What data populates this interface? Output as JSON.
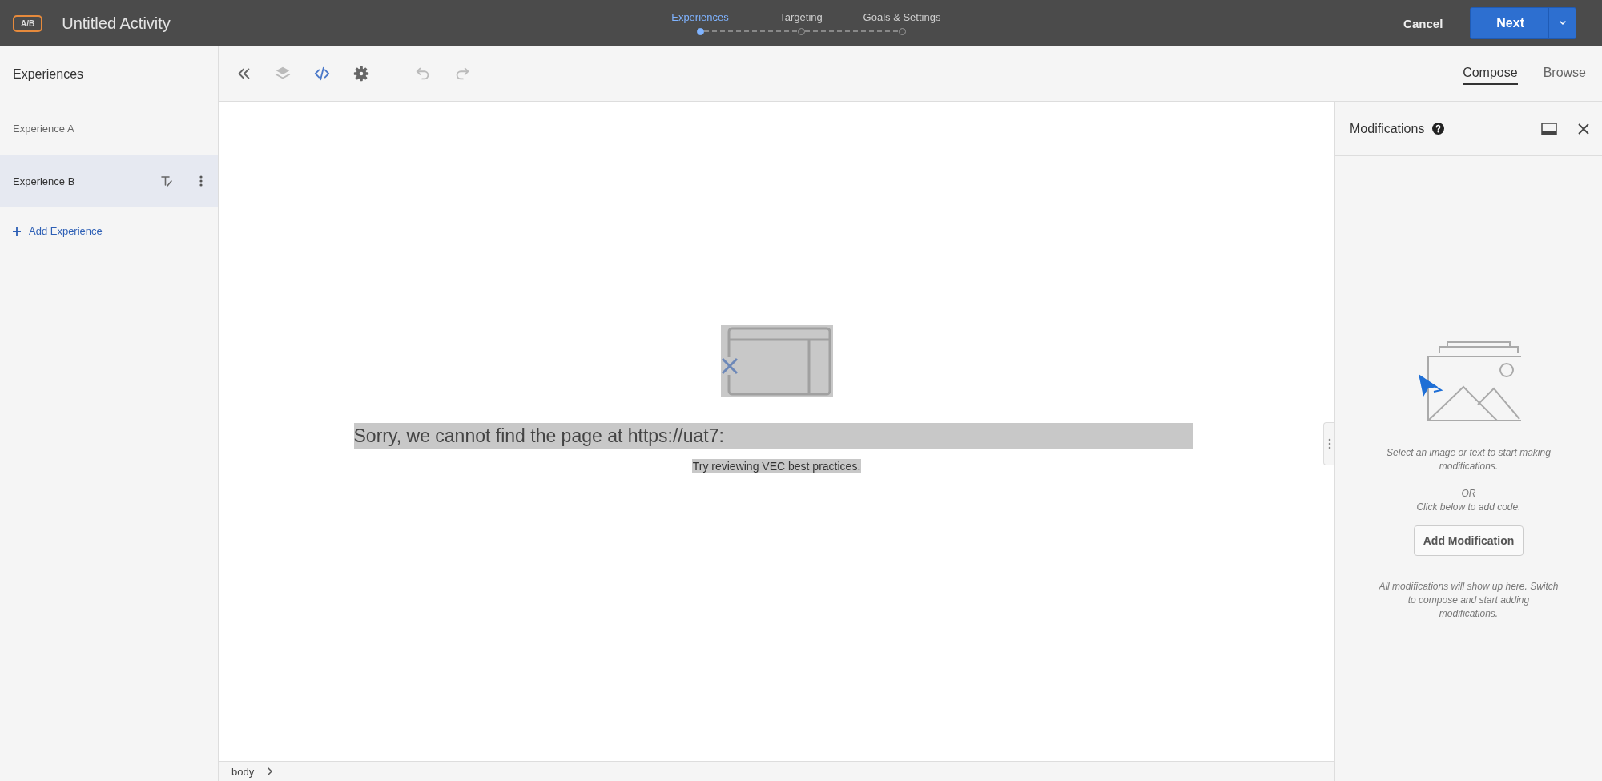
{
  "header": {
    "badge": "A/B",
    "title": "Untitled Activity",
    "steps": [
      {
        "label": "Experiences",
        "selected": true
      },
      {
        "label": "Targeting",
        "selected": false
      },
      {
        "label": "Goals & Settings",
        "selected": false
      }
    ],
    "cancel": "Cancel",
    "next": "Next"
  },
  "sidebar": {
    "title": "Experiences",
    "items": [
      {
        "label": "Experience A",
        "selected": false
      },
      {
        "label": "Experience B",
        "selected": true
      }
    ],
    "add": "Add Experience"
  },
  "toolbar": [
    {
      "kind": "collapse",
      "disabled": false
    },
    {
      "kind": "layers",
      "disabled": true
    },
    {
      "kind": "code",
      "disabled": false
    },
    {
      "kind": "settings",
      "disabled": false
    },
    {
      "kind": "undo",
      "disabled": true
    },
    {
      "kind": "redo",
      "disabled": true
    }
  ],
  "modes": [
    {
      "label": "Compose",
      "selected": true
    },
    {
      "label": "Browse",
      "selected": false
    }
  ],
  "canvas": {
    "error": "Sorry, we cannot find the page at https://uat7:",
    "hint": "Try reviewing VEC best practices."
  },
  "breadcrumb": {
    "label": "body"
  },
  "panel": {
    "title": "Modifications",
    "instructions": "Select an image or text to start making modifications.",
    "or": "OR",
    "code_hint": "Click below to add code.",
    "button": "Add Modification",
    "footer": "All modifications will show up here. Switch to compose and start adding modifications."
  }
}
